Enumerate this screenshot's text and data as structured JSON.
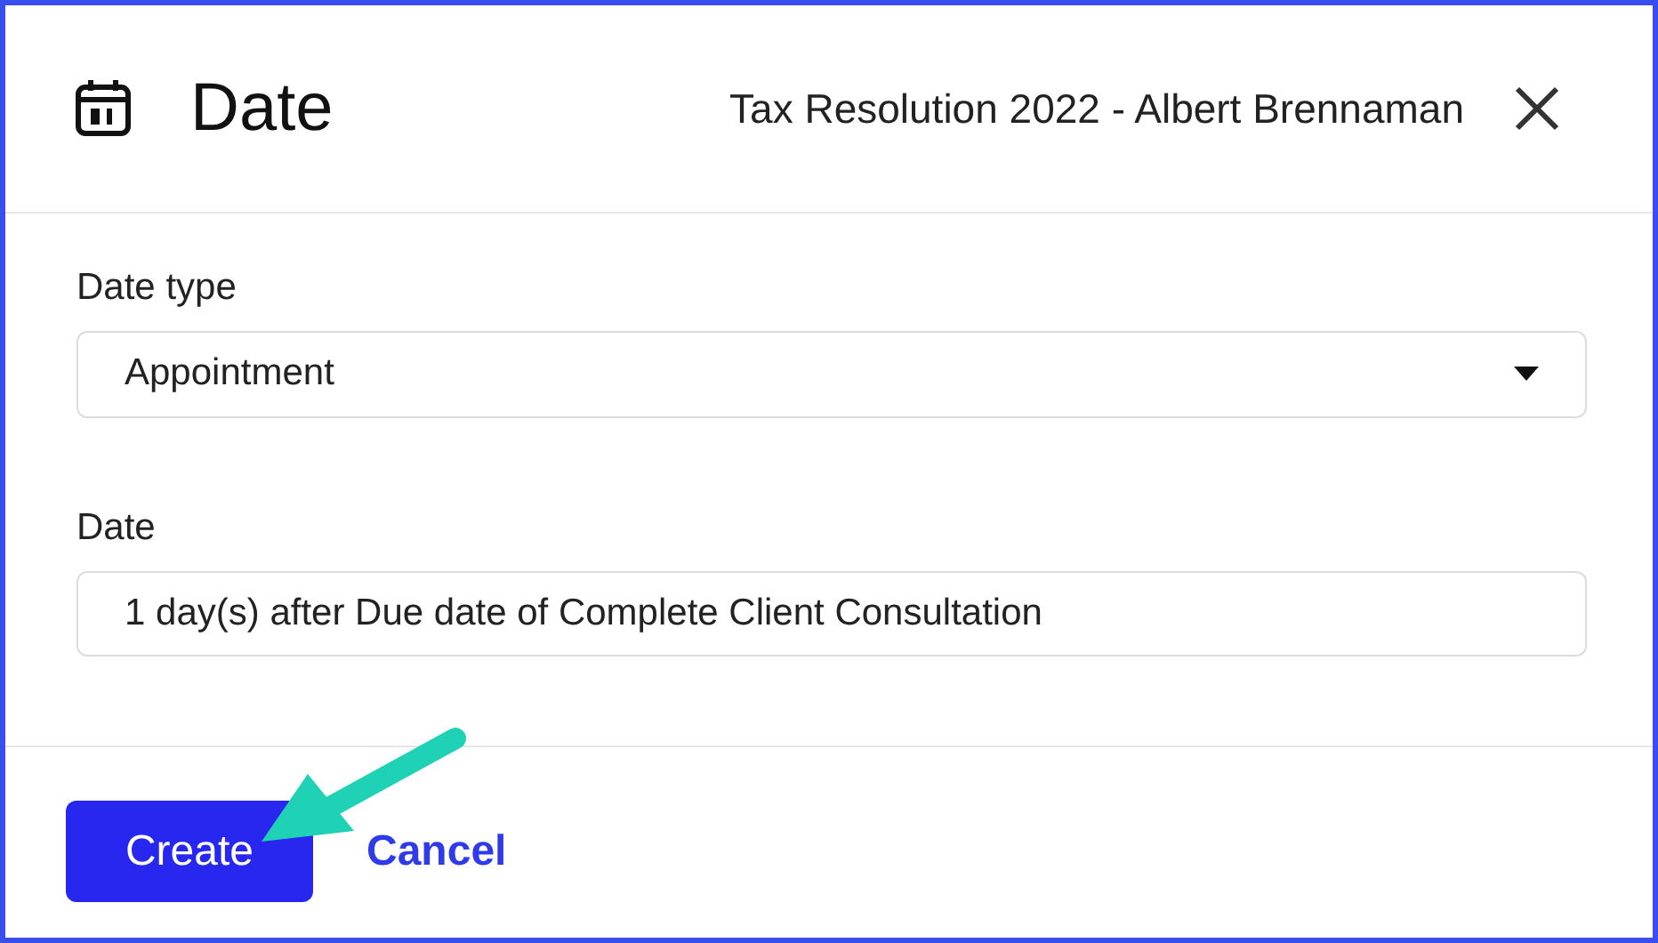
{
  "dialog": {
    "title": "Date",
    "context": "Tax Resolution 2022 - Albert Brennaman"
  },
  "fields": [
    {
      "kind": "select",
      "label": "Date type",
      "value": "Appointment"
    },
    {
      "kind": "text",
      "label": "Date",
      "value": "1 day(s) after Due date of Complete Client Consultation"
    }
  ],
  "buttons": [
    {
      "kind": "primary",
      "label": "Create"
    },
    {
      "kind": "link",
      "label": "Cancel"
    }
  ]
}
